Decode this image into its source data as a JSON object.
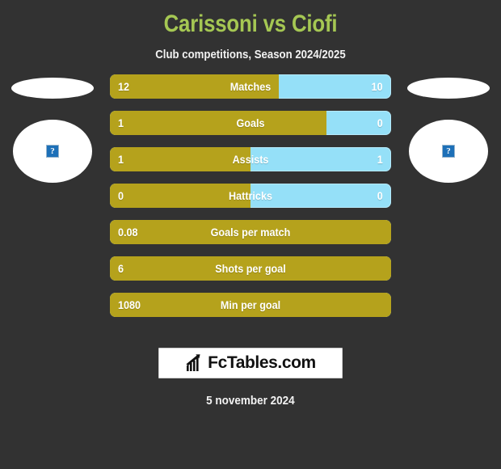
{
  "colors": {
    "background": "#323232",
    "title": "#a5c753",
    "bar_home": "#b5a21c",
    "bar_away": "#95e0f8",
    "text": "#ffffff"
  },
  "header": {
    "title": "Carissoni vs Ciofi",
    "subtitle": "Club competitions, Season 2024/2025"
  },
  "players": {
    "home": {
      "placeholder_glyph": "?"
    },
    "away": {
      "placeholder_glyph": "?"
    }
  },
  "chart_data": {
    "type": "bar",
    "title": "Carissoni vs Ciofi",
    "subtitle": "Club competitions, Season 2024/2025",
    "orientation": "horizontal-diverging",
    "series": [
      {
        "name": "Carissoni",
        "color": "#b5a21c"
      },
      {
        "name": "Ciofi",
        "color": "#95e0f8"
      }
    ],
    "categories": [
      "Matches",
      "Goals",
      "Assists",
      "Hattricks",
      "Goals per match",
      "Shots per goal",
      "Min per goal"
    ],
    "rows": [
      {
        "label": "Matches",
        "home": "12",
        "away": "10",
        "home_pct": 60,
        "two_sided": true
      },
      {
        "label": "Goals",
        "home": "1",
        "away": "0",
        "home_pct": 77,
        "two_sided": true
      },
      {
        "label": "Assists",
        "home": "1",
        "away": "1",
        "home_pct": 50,
        "two_sided": true
      },
      {
        "label": "Hattricks",
        "home": "0",
        "away": "0",
        "home_pct": 50,
        "two_sided": true
      },
      {
        "label": "Goals per match",
        "home": "0.08",
        "away": "",
        "home_pct": 100,
        "two_sided": false
      },
      {
        "label": "Shots per goal",
        "home": "6",
        "away": "",
        "home_pct": 100,
        "two_sided": false
      },
      {
        "label": "Min per goal",
        "home": "1080",
        "away": "",
        "home_pct": 100,
        "two_sided": false
      }
    ]
  },
  "footer": {
    "logo_text": "FcTables.com",
    "logo_icon": "bar-chart-icon",
    "date": "5 november 2024"
  }
}
